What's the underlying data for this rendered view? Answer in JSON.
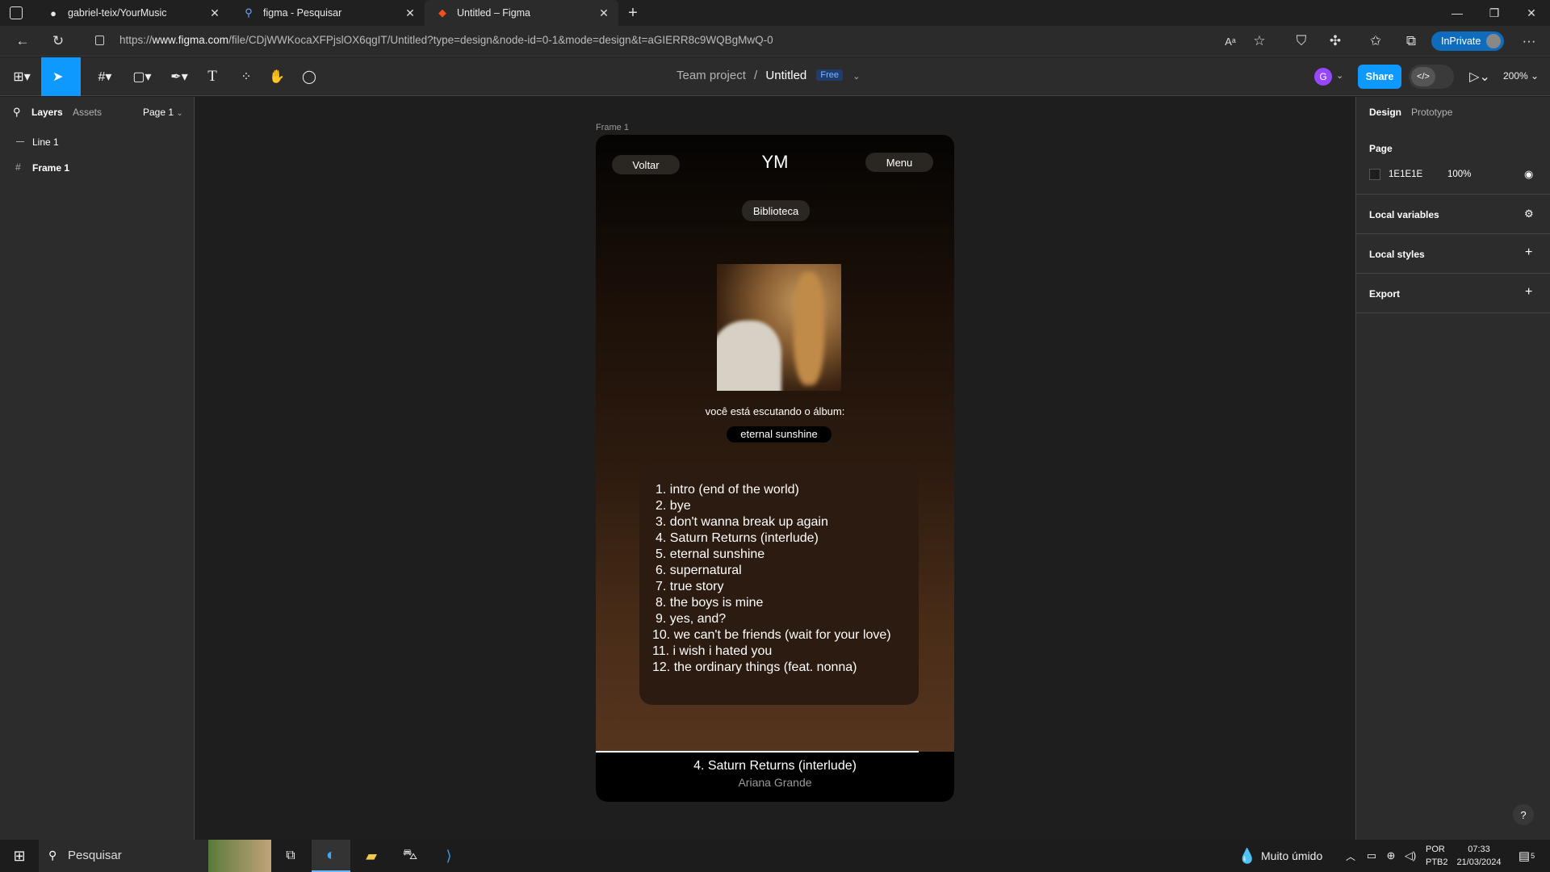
{
  "browser": {
    "tabs": [
      {
        "title": "gabriel-teix/YourMusic",
        "icon": "github-icon"
      },
      {
        "title": "figma - Pesquisar",
        "icon": "search-icon"
      },
      {
        "title": "Untitled – Figma",
        "icon": "figma-icon"
      }
    ],
    "url_prefix": "https://",
    "url_host": "www.figma.com",
    "url_path": "/file/CDjWWKocaXFPjslOX6qgIT/Untitled?type=design&node-id=0-1&mode=design&t=aGIERR8c9WQBgMwQ-0",
    "inprivate_label": "InPrivate"
  },
  "figma": {
    "breadcrumb": {
      "team": "Team project",
      "separator": "/",
      "file": "Untitled",
      "badge": "Free"
    },
    "avatar_initial": "G",
    "share_label": "Share",
    "zoom": "200%"
  },
  "left_panel": {
    "tabs": [
      "Layers",
      "Assets"
    ],
    "page_select": "Page 1",
    "layers": [
      {
        "name": "Line 1",
        "icon": "line-icon"
      },
      {
        "name": "Frame 1",
        "icon": "frame-icon"
      }
    ]
  },
  "right_panel": {
    "tabs": [
      "Design",
      "Prototype"
    ],
    "page_heading": "Page",
    "page_color_hex": "1E1E1E",
    "page_color": "#1e1e1e",
    "page_opacity": "100%",
    "local_variables": "Local variables",
    "local_styles": "Local styles",
    "export": "Export",
    "help": "?"
  },
  "canvas": {
    "frame_label": "Frame 1",
    "app": {
      "back_button": "Voltar",
      "logo": "YM",
      "menu_button": "Menu",
      "library_button": "Biblioteca",
      "listening_caption": "você está escutando o álbum:",
      "album_name": "eternal sunshine",
      "tracks": [
        "1. intro (end of the world)",
        "2. bye",
        "3. don't wanna break up again",
        "4. Saturn Returns (interlude)",
        "5. eternal sunshine",
        "6. supernatural",
        "7. true story",
        "8. the boys is mine",
        "9. yes, and?",
        "10. we can't be friends (wait for your love)",
        "11. i wish i hated you",
        "12. the ordinary things (feat. nonna)"
      ],
      "now_playing_title": "4. Saturn Returns (interlude)",
      "now_playing_artist": "Ariana Grande"
    }
  },
  "taskbar": {
    "search_placeholder": "Pesquisar",
    "weather": "Muito úmido",
    "lang_top": "POR",
    "lang_bottom": "PTB2",
    "time": "07:33",
    "date": "21/03/2024",
    "notifications": "5"
  }
}
